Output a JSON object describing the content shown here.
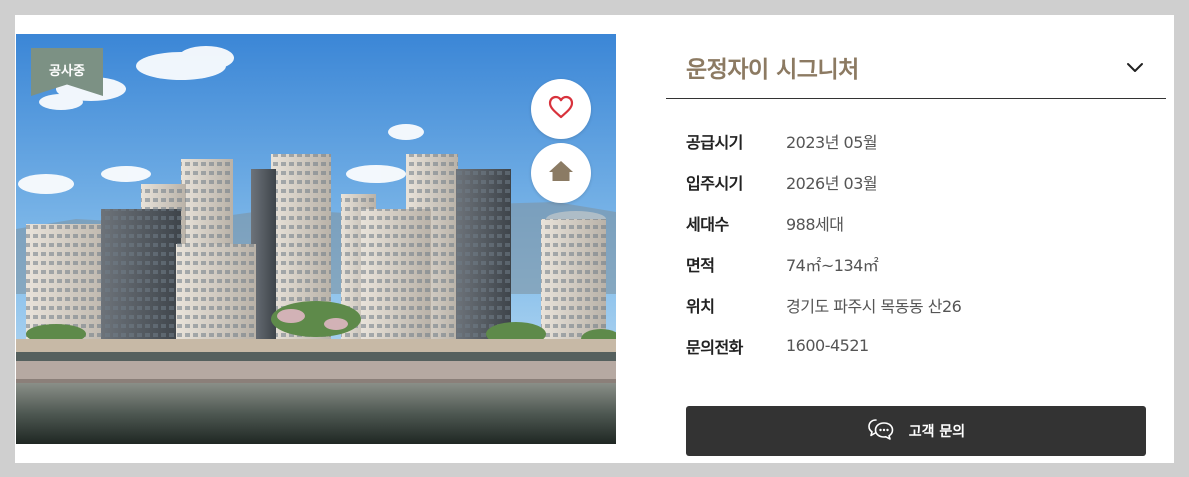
{
  "listing": {
    "status_badge": "공사중",
    "title": "운정자이 시그니처"
  },
  "details": [
    {
      "label": "공급시기",
      "value": "2023년 05월"
    },
    {
      "label": "입주시기",
      "value": "2026년 03월"
    },
    {
      "label": "세대수",
      "value": "988세대"
    },
    {
      "label": "면적",
      "value": "74㎡~134㎡"
    },
    {
      "label": "위치",
      "value": "경기도 파주시 목동동 산26"
    },
    {
      "label": "문의전화",
      "value": "1600-4521"
    }
  ],
  "contact": {
    "label": "고객 문의"
  },
  "icons": {
    "favorite": "heart-outline-icon",
    "home": "home-icon",
    "expand": "chevron-down-icon",
    "chat": "chat-bubble-icon"
  },
  "colors": {
    "badge": "#7c9184",
    "title": "#8c7a62",
    "heart": "#d8323c",
    "home_icon": "#8b7b64",
    "button": "#333333"
  }
}
